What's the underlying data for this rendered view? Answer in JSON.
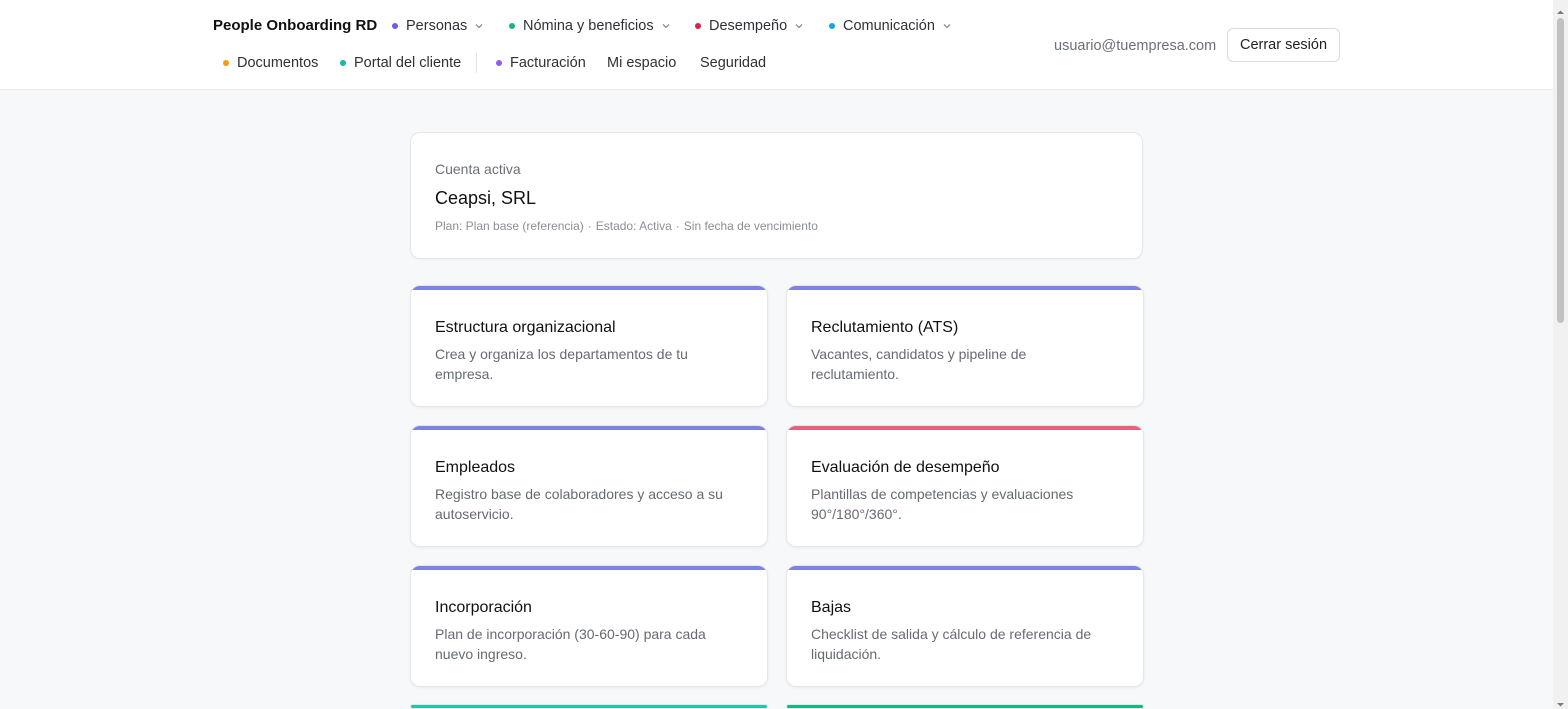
{
  "header": {
    "brand": "People Onboarding RD",
    "nav": [
      {
        "label": "Personas",
        "dot": "#6c5ce7",
        "dropdown": true
      },
      {
        "label": "Nómina y beneficios",
        "dot": "#10b981",
        "dropdown": true
      },
      {
        "label": "Desempeño",
        "dot": "#e11d48",
        "dropdown": true
      },
      {
        "label": "Comunicación",
        "dot": "#0ea5e9",
        "dropdown": true
      },
      {
        "label": "Documentos",
        "dot": "#f59e0b",
        "dropdown": false
      },
      {
        "label": "Portal del cliente",
        "dot": "#14b8a6",
        "dropdown": false
      },
      {
        "label": "Facturación",
        "dot": "#8b5cf6",
        "dropdown": false
      },
      {
        "label": "Mi espacio",
        "dot": null,
        "dropdown": false
      },
      {
        "label": "Seguridad",
        "dot": null,
        "dropdown": false
      }
    ],
    "user_email": "usuario@tuempresa.com",
    "logout_label": "Cerrar sesión"
  },
  "account": {
    "label": "Cuenta activa",
    "name": "Ceapsi, SRL",
    "plan": "Plan: Plan base (referencia)",
    "separator": "·",
    "status": "Estado: Activa",
    "expiry": "Sin fecha de vencimiento"
  },
  "modules": [
    {
      "title": "Estructura organizacional",
      "description": "Crea y organiza los departamentos de tu empresa.",
      "accent": "#7c83e0"
    },
    {
      "title": "Reclutamiento (ATS)",
      "description": "Vacantes, candidatos y pipeline de reclutamiento.",
      "accent": "#7c83e0"
    },
    {
      "title": "Empleados",
      "description": "Registro base de colaboradores y acceso a su autoservicio.",
      "accent": "#7c83e0"
    },
    {
      "title": "Evaluación de desempeño",
      "description": "Plantillas de competencias y evaluaciones 90°/180°/360°.",
      "accent": "#e8617a"
    },
    {
      "title": "Incorporación",
      "description": "Plan de incorporación (30-60-90) para cada nuevo ingreso.",
      "accent": "#7c83e0"
    },
    {
      "title": "Bajas",
      "description": "Checklist de salida y cálculo de referencia de liquidación.",
      "accent": "#7c83e0"
    },
    {
      "title": "",
      "description": "",
      "accent": "#1fc8a8"
    },
    {
      "title": "",
      "description": "",
      "accent": "#10b981"
    }
  ]
}
